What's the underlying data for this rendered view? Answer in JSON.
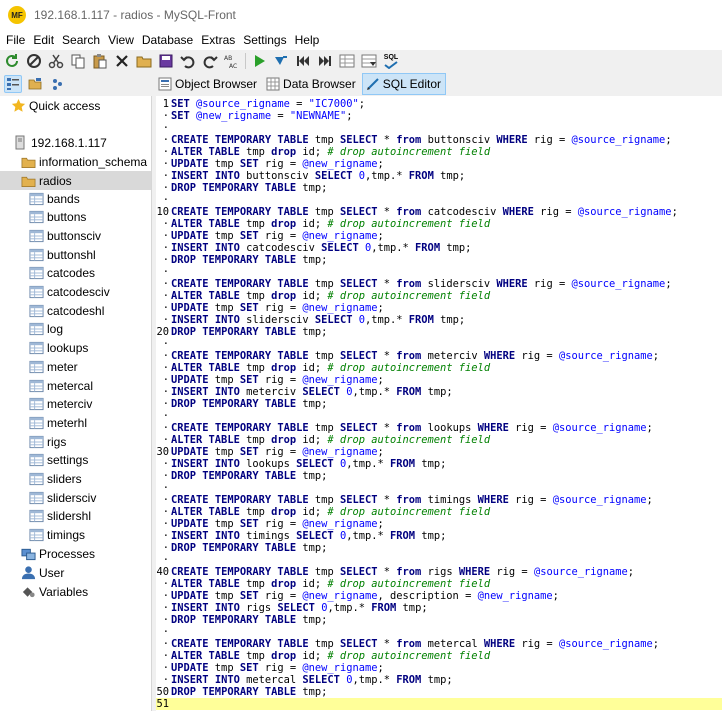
{
  "window": {
    "logo": "MF",
    "title": "192.168.1.117 - radios - MySQL-Front"
  },
  "menu": [
    "File",
    "Edit",
    "Search",
    "View",
    "Database",
    "Extras",
    "Settings",
    "Help"
  ],
  "toolbar": {
    "icons": [
      "refresh-icon",
      "stop-icon",
      "cut-icon",
      "copy-icon",
      "paste-icon",
      "delete-icon",
      "open-icon",
      "save-icon",
      "undo-icon",
      "redo-icon",
      "replace-icon",
      "run-icon",
      "run-selection-icon",
      "first-icon",
      "last-icon",
      "grid-icon",
      "grid-post-icon",
      "sql-check-icon"
    ],
    "sql_check_label": "SQL"
  },
  "tabs": [
    {
      "label": "Object Browser",
      "icon": "object-browser-icon",
      "active": false
    },
    {
      "label": "Data Browser",
      "icon": "data-browser-icon",
      "active": false
    },
    {
      "label": "SQL Editor",
      "icon": "sql-editor-icon",
      "active": true
    }
  ],
  "sidebar": {
    "quick_access": "Quick access",
    "server": "192.168.1.117",
    "databases": [
      "information_schema",
      "radios"
    ],
    "tables": [
      "bands",
      "buttons",
      "buttonsciv",
      "buttonshl",
      "catcodes",
      "catcodesciv",
      "catcodeshl",
      "log",
      "lookups",
      "meter",
      "metercal",
      "meterciv",
      "meterhl",
      "rigs",
      "settings",
      "sliders",
      "slidersciv",
      "slidershl",
      "timings"
    ],
    "footer": [
      "Processes",
      "User",
      "Variables"
    ]
  },
  "colors": {
    "keyword": "#000080",
    "comment": "#008000",
    "string": "#0000ff",
    "current_line": "#ffff99",
    "selection": "#cce4f7"
  },
  "editor": {
    "current_line": 51,
    "lines": [
      "SET @source_rigname = \"IC7000\";",
      "SET @new_rigname = \"NEWNAME\";",
      "",
      "CREATE TEMPORARY TABLE tmp SELECT * from buttonsciv WHERE rig = @source_rigname;",
      "ALTER TABLE tmp drop id; # drop autoincrement field",
      "UPDATE tmp SET rig = @new_rigname;",
      "INSERT INTO buttonsciv SELECT 0,tmp.* FROM tmp;",
      "DROP TEMPORARY TABLE tmp;",
      "",
      "CREATE TEMPORARY TABLE tmp SELECT * from catcodesciv WHERE rig = @source_rigname;",
      "ALTER TABLE tmp drop id; # drop autoincrement field",
      "UPDATE tmp SET rig = @new_rigname;",
      "INSERT INTO catcodesciv SELECT 0,tmp.* FROM tmp;",
      "DROP TEMPORARY TABLE tmp;",
      "",
      "CREATE TEMPORARY TABLE tmp SELECT * from slidersciv WHERE rig = @source_rigname;",
      "ALTER TABLE tmp drop id; # drop autoincrement field",
      "UPDATE tmp SET rig = @new_rigname;",
      "INSERT INTO slidersciv SELECT 0,tmp.* FROM tmp;",
      "DROP TEMPORARY TABLE tmp;",
      "",
      "CREATE TEMPORARY TABLE tmp SELECT * from meterciv WHERE rig = @source_rigname;",
      "ALTER TABLE tmp drop id; # drop autoincrement field",
      "UPDATE tmp SET rig = @new_rigname;",
      "INSERT INTO meterciv SELECT 0,tmp.* FROM tmp;",
      "DROP TEMPORARY TABLE tmp;",
      "",
      "CREATE TEMPORARY TABLE tmp SELECT * from lookups WHERE rig = @source_rigname;",
      "ALTER TABLE tmp drop id; # drop autoincrement field",
      "UPDATE tmp SET rig = @new_rigname;",
      "INSERT INTO lookups SELECT 0,tmp.* FROM tmp;",
      "DROP TEMPORARY TABLE tmp;",
      "",
      "CREATE TEMPORARY TABLE tmp SELECT * from timings WHERE rig = @source_rigname;",
      "ALTER TABLE tmp drop id; # drop autoincrement field",
      "UPDATE tmp SET rig = @new_rigname;",
      "INSERT INTO timings SELECT 0,tmp.* FROM tmp;",
      "DROP TEMPORARY TABLE tmp;",
      "",
      "CREATE TEMPORARY TABLE tmp SELECT * from rigs WHERE rig = @source_rigname;",
      "ALTER TABLE tmp drop id; # drop autoincrement field",
      "UPDATE tmp SET rig = @new_rigname, description = @new_rigname;",
      "INSERT INTO rigs SELECT 0,tmp.* FROM tmp;",
      "DROP TEMPORARY TABLE tmp;",
      "",
      "CREATE TEMPORARY TABLE tmp SELECT * from metercal WHERE rig = @source_rigname;",
      "ALTER TABLE tmp drop id; # drop autoincrement field",
      "UPDATE tmp SET rig = @new_rigname;",
      "INSERT INTO metercal SELECT 0,tmp.* FROM tmp;",
      "DROP TEMPORARY TABLE tmp;",
      ""
    ]
  }
}
